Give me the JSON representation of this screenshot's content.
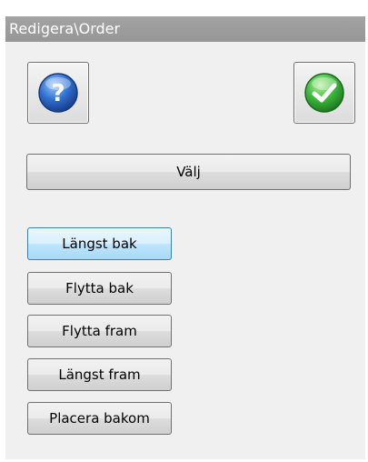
{
  "panel": {
    "title": "Redigera\\Order"
  },
  "toolbar": {
    "help_icon": "help-icon",
    "ok_icon": "checkmark-icon"
  },
  "select_button": {
    "label": "Välj"
  },
  "order_buttons": [
    {
      "label": "Längst bak",
      "focused": true
    },
    {
      "label": "Flytta bak"
    },
    {
      "label": "Flytta fram"
    },
    {
      "label": "Längst fram"
    },
    {
      "label": "Placera bakom"
    }
  ],
  "colors": {
    "titlebar": "#9c9c9c",
    "panel_bg": "#f0f0f0",
    "help_icon": "#2f6fcf",
    "ok_icon": "#3cb83c",
    "focus_border": "#3c7fb1"
  }
}
